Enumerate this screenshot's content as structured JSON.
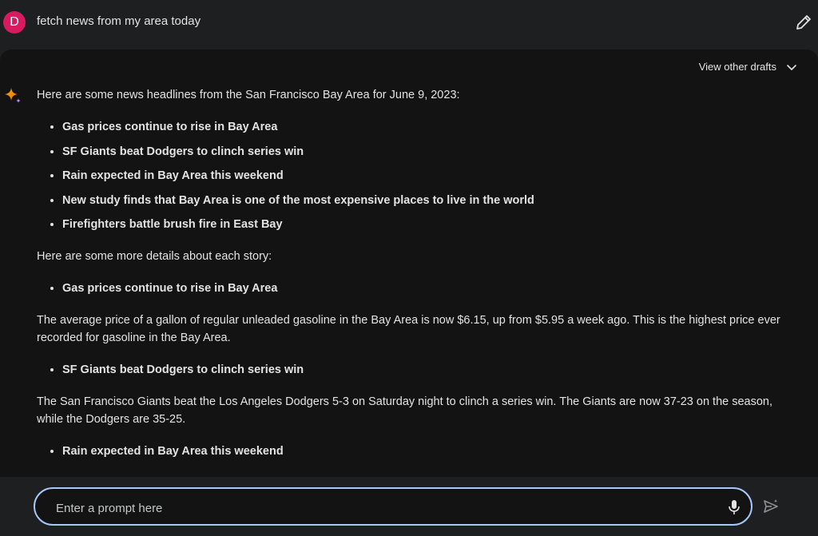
{
  "user": {
    "avatar_letter": "D",
    "prompt": "fetch news from my area today"
  },
  "response": {
    "view_drafts": "View other drafts",
    "intro": "Here are some news headlines from the San Francisco Bay Area for June 9, 2023:",
    "headlines": [
      "Gas prices continue to rise in Bay Area",
      "SF Giants beat Dodgers to clinch series win",
      "Rain expected in Bay Area this weekend",
      "New study finds that Bay Area is one of the most expensive places to live in the world",
      "Firefighters battle brush fire in East Bay"
    ],
    "details_intro": "Here are some more details about each story:",
    "details": [
      {
        "heading": "Gas prices continue to rise in Bay Area",
        "body": "The average price of a gallon of regular unleaded gasoline in the Bay Area is now $6.15, up from $5.95 a week ago. This is the highest price ever recorded for gasoline in the Bay Area."
      },
      {
        "heading": "SF Giants beat Dodgers to clinch series win",
        "body": "The San Francisco Giants beat the Los Angeles Dodgers 5-3 on Saturday night to clinch a series win. The Giants are now 37-23 on the season, while the Dodgers are 35-25."
      },
      {
        "heading": "Rain expected in Bay Area this weekend",
        "body": ""
      }
    ]
  },
  "input": {
    "placeholder": "Enter a prompt here"
  },
  "colors": {
    "accent": "#a8c7fa",
    "avatar": "#d81b60",
    "background": "#131314"
  }
}
